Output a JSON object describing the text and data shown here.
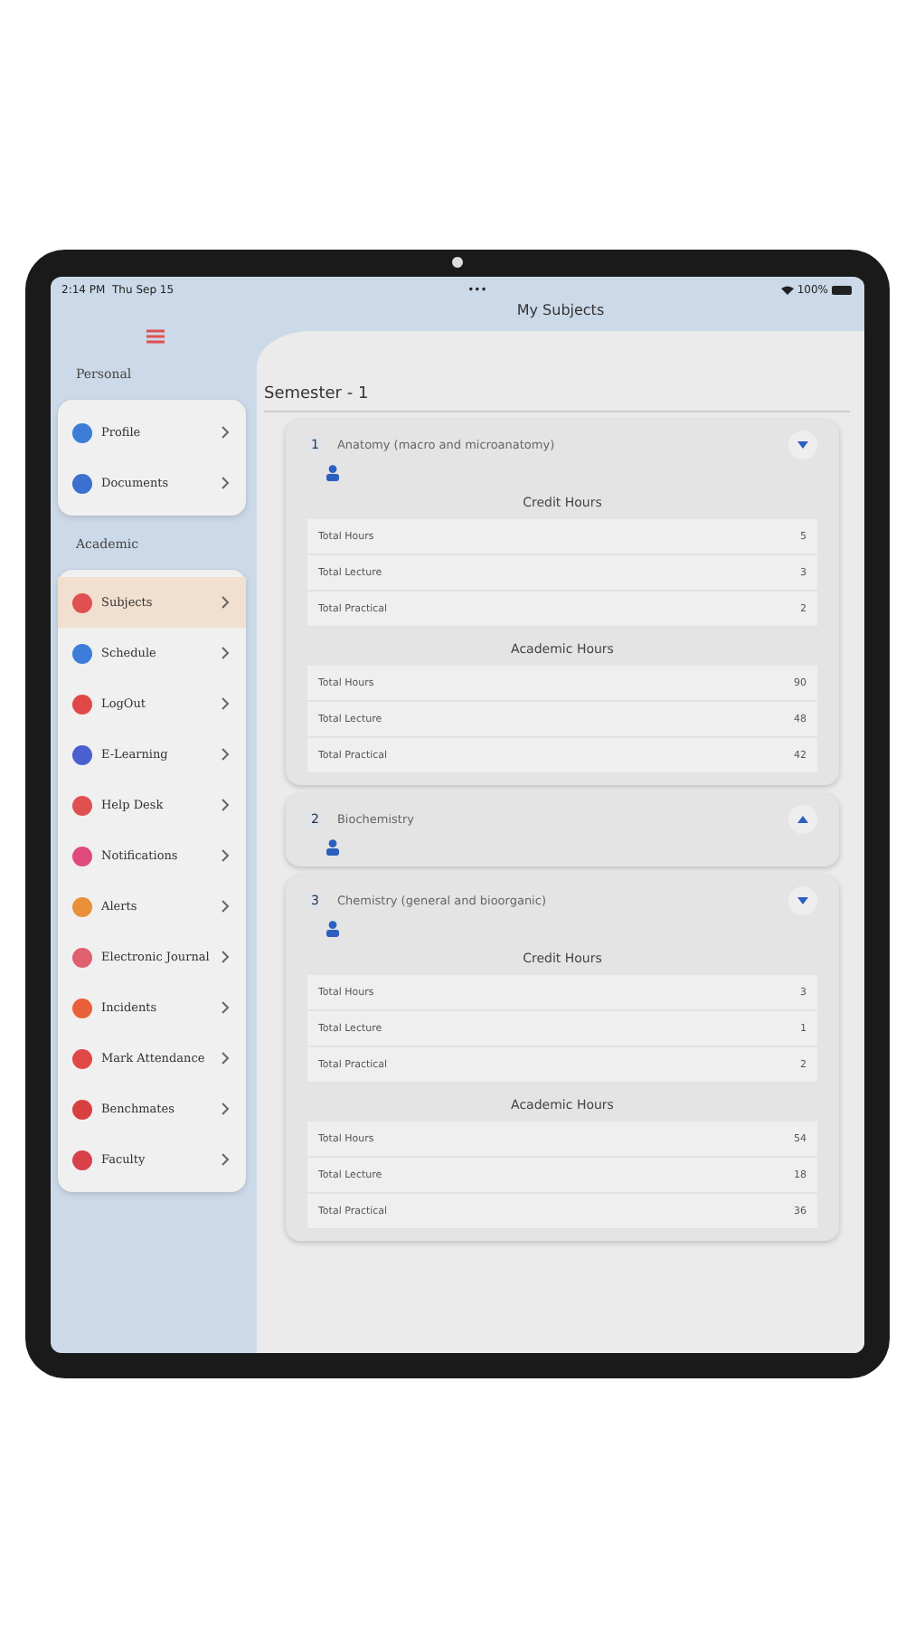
{
  "status_bar": {
    "time": "2:14 PM",
    "date": "Thu Sep 15",
    "dots": "•••",
    "battery": "100%"
  },
  "header": {
    "title": "My Subjects"
  },
  "sidebar": {
    "groups": [
      {
        "title": "Personal",
        "items": [
          {
            "label": "Profile",
            "color": "#3b7dd8",
            "selected": false
          },
          {
            "label": "Documents",
            "color": "#3b6fd0",
            "selected": false
          }
        ]
      },
      {
        "title": "Academic",
        "items": [
          {
            "label": "Subjects",
            "color": "#e05050",
            "selected": true
          },
          {
            "label": "Schedule",
            "color": "#3b7dd8",
            "selected": false
          },
          {
            "label": "LogOut",
            "color": "#e04848",
            "selected": false
          },
          {
            "label": "E-Learning",
            "color": "#4a5fd0",
            "selected": false
          },
          {
            "label": "Help Desk",
            "color": "#e05050",
            "selected": false
          },
          {
            "label": "Notifications",
            "color": "#e04a7a",
            "selected": false
          },
          {
            "label": "Alerts",
            "color": "#e8913a",
            "selected": false
          },
          {
            "label": "Electronic Journal",
            "color": "#e06070",
            "selected": false
          },
          {
            "label": "Incidents",
            "color": "#e8603a",
            "selected": false
          },
          {
            "label": "Mark Attendance",
            "color": "#e04848",
            "selected": false
          },
          {
            "label": "Benchmates",
            "color": "#d84040",
            "selected": false
          },
          {
            "label": "Faculty",
            "color": "#d8404a",
            "selected": false
          }
        ]
      }
    ]
  },
  "semester": "Semester - 1",
  "subjects": [
    {
      "number": "1",
      "name": "Anatomy (macro and microanatomy)",
      "expanded": true,
      "sections": [
        {
          "title": "Credit Hours",
          "rows": [
            {
              "label": "Total Hours",
              "value": "5"
            },
            {
              "label": "Total Lecture",
              "value": "3"
            },
            {
              "label": "Total Practical",
              "value": "2"
            }
          ]
        },
        {
          "title": "Academic Hours",
          "rows": [
            {
              "label": "Total Hours",
              "value": "90"
            },
            {
              "label": "Total Lecture",
              "value": "48"
            },
            {
              "label": "Total Practical",
              "value": "42"
            }
          ]
        }
      ]
    },
    {
      "number": "2",
      "name": "Biochemistry",
      "expanded": false
    },
    {
      "number": "3",
      "name": "Chemistry (general and bioorganic)",
      "expanded": true,
      "sections": [
        {
          "title": "Credit Hours",
          "rows": [
            {
              "label": "Total Hours",
              "value": "3"
            },
            {
              "label": "Total Lecture",
              "value": "1"
            },
            {
              "label": "Total Practical",
              "value": "2"
            }
          ]
        },
        {
          "title": "Academic Hours",
          "rows": [
            {
              "label": "Total Hours",
              "value": "54"
            },
            {
              "label": "Total Lecture",
              "value": "18"
            },
            {
              "label": "Total Practical",
              "value": "36"
            }
          ]
        }
      ]
    }
  ]
}
